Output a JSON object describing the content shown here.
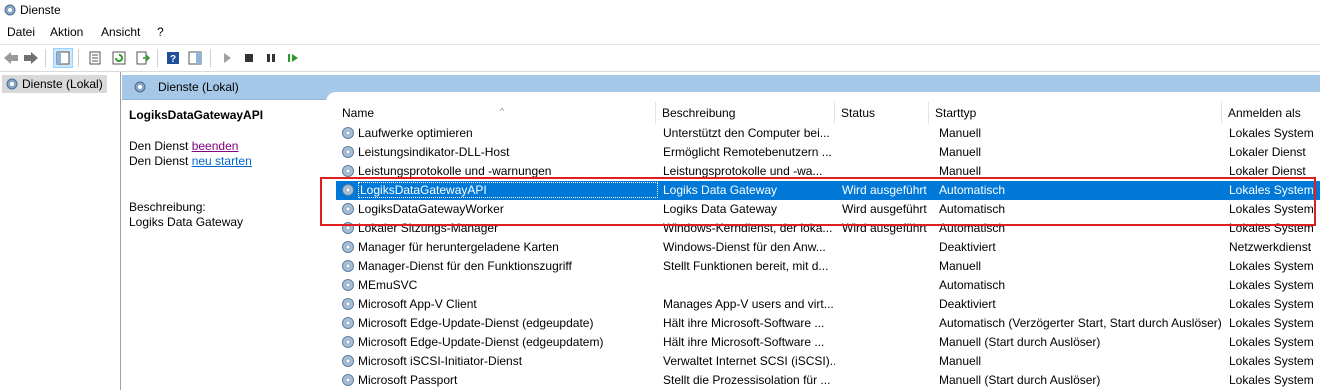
{
  "window": {
    "title": "Dienste"
  },
  "menu": [
    "Datei",
    "Aktion",
    "Ansicht",
    "?"
  ],
  "toolbar": {
    "icons": [
      "back-icon",
      "forward-icon",
      "show-hide-console-tree-icon",
      "properties-icon",
      "refresh-icon",
      "export-list-icon",
      "help-icon",
      "show-hide-action-pane-icon",
      "start-service-icon",
      "stop-service-icon",
      "pause-service-icon",
      "resume-service-icon"
    ]
  },
  "tree": {
    "node": "Dienste (Lokal)"
  },
  "header": {
    "title": "Dienste (Lokal)"
  },
  "description": {
    "service_name": "LogiksDataGatewayAPI",
    "line1_prefix": "Den Dienst ",
    "line1_link": "beenden",
    "line2_prefix": "Den Dienst ",
    "line2_link": "neu starten",
    "label": "Beschreibung:",
    "text": "Logiks Data Gateway"
  },
  "columns": [
    "Name",
    "Beschreibung",
    "Status",
    "Starttyp",
    "Anmelden als"
  ],
  "rows": [
    {
      "name": "Laufwerke optimieren",
      "desc": "Unterstützt den Computer bei...",
      "status": "",
      "start": "Manuell",
      "logon": "Lokales System"
    },
    {
      "name": "Leistungsindikator-DLL-Host",
      "desc": "Ermöglicht Remotebenutzern ...",
      "status": "",
      "start": "Manuell",
      "logon": "Lokaler Dienst"
    },
    {
      "name": "Leistungsprotokolle und -warnungen",
      "desc": "Leistungsprotokolle und -wa...",
      "status": "",
      "start": "Manuell",
      "logon": "Lokaler Dienst"
    },
    {
      "name": "LogiksDataGatewayAPI",
      "desc": "Logiks Data Gateway",
      "status": "Wird ausgeführt",
      "start": "Automatisch",
      "logon": "Lokales System",
      "selected": true
    },
    {
      "name": "LogiksDataGatewayWorker",
      "desc": "Logiks Data Gateway",
      "status": "Wird ausgeführt",
      "start": "Automatisch",
      "logon": "Lokales System"
    },
    {
      "name": "Lokaler Sitzungs-Manager",
      "desc": "Windows-Kerndienst, der loka...",
      "status": "Wird ausgeführt",
      "start": "Automatisch",
      "logon": "Lokales System"
    },
    {
      "name": "Manager für heruntergeladene Karten",
      "desc": "Windows-Dienst für den Anw...",
      "status": "",
      "start": "Deaktiviert",
      "logon": "Netzwerkdienst"
    },
    {
      "name": "Manager-Dienst für den Funktionszugriff",
      "desc": "Stellt Funktionen bereit, mit d...",
      "status": "",
      "start": "Manuell",
      "logon": "Lokales System"
    },
    {
      "name": "MEmuSVC",
      "desc": "",
      "status": "",
      "start": "Automatisch",
      "logon": "Lokales System"
    },
    {
      "name": "Microsoft App-V Client",
      "desc": "Manages App-V users and virt...",
      "status": "",
      "start": "Deaktiviert",
      "logon": "Lokales System"
    },
    {
      "name": "Microsoft Edge-Update-Dienst (edgeupdate)",
      "desc": "Hält ihre Microsoft-Software ...",
      "status": "",
      "start": "Automatisch (Verzögerter Start, Start durch Auslöser)",
      "logon": "Lokales System"
    },
    {
      "name": "Microsoft Edge-Update-Dienst (edgeupdatem)",
      "desc": "Hält ihre Microsoft-Software ...",
      "status": "",
      "start": "Manuell (Start durch Auslöser)",
      "logon": "Lokales System"
    },
    {
      "name": "Microsoft iSCSI-Initiator-Dienst",
      "desc": "Verwaltet Internet SCSI (iSCSI)...",
      "status": "",
      "start": "Manuell",
      "logon": "Lokales System"
    },
    {
      "name": "Microsoft Passport",
      "desc": "Stellt die Prozessisolation für ...",
      "status": "",
      "start": "Manuell (Start durch Auslöser)",
      "logon": "Lokales System"
    }
  ]
}
